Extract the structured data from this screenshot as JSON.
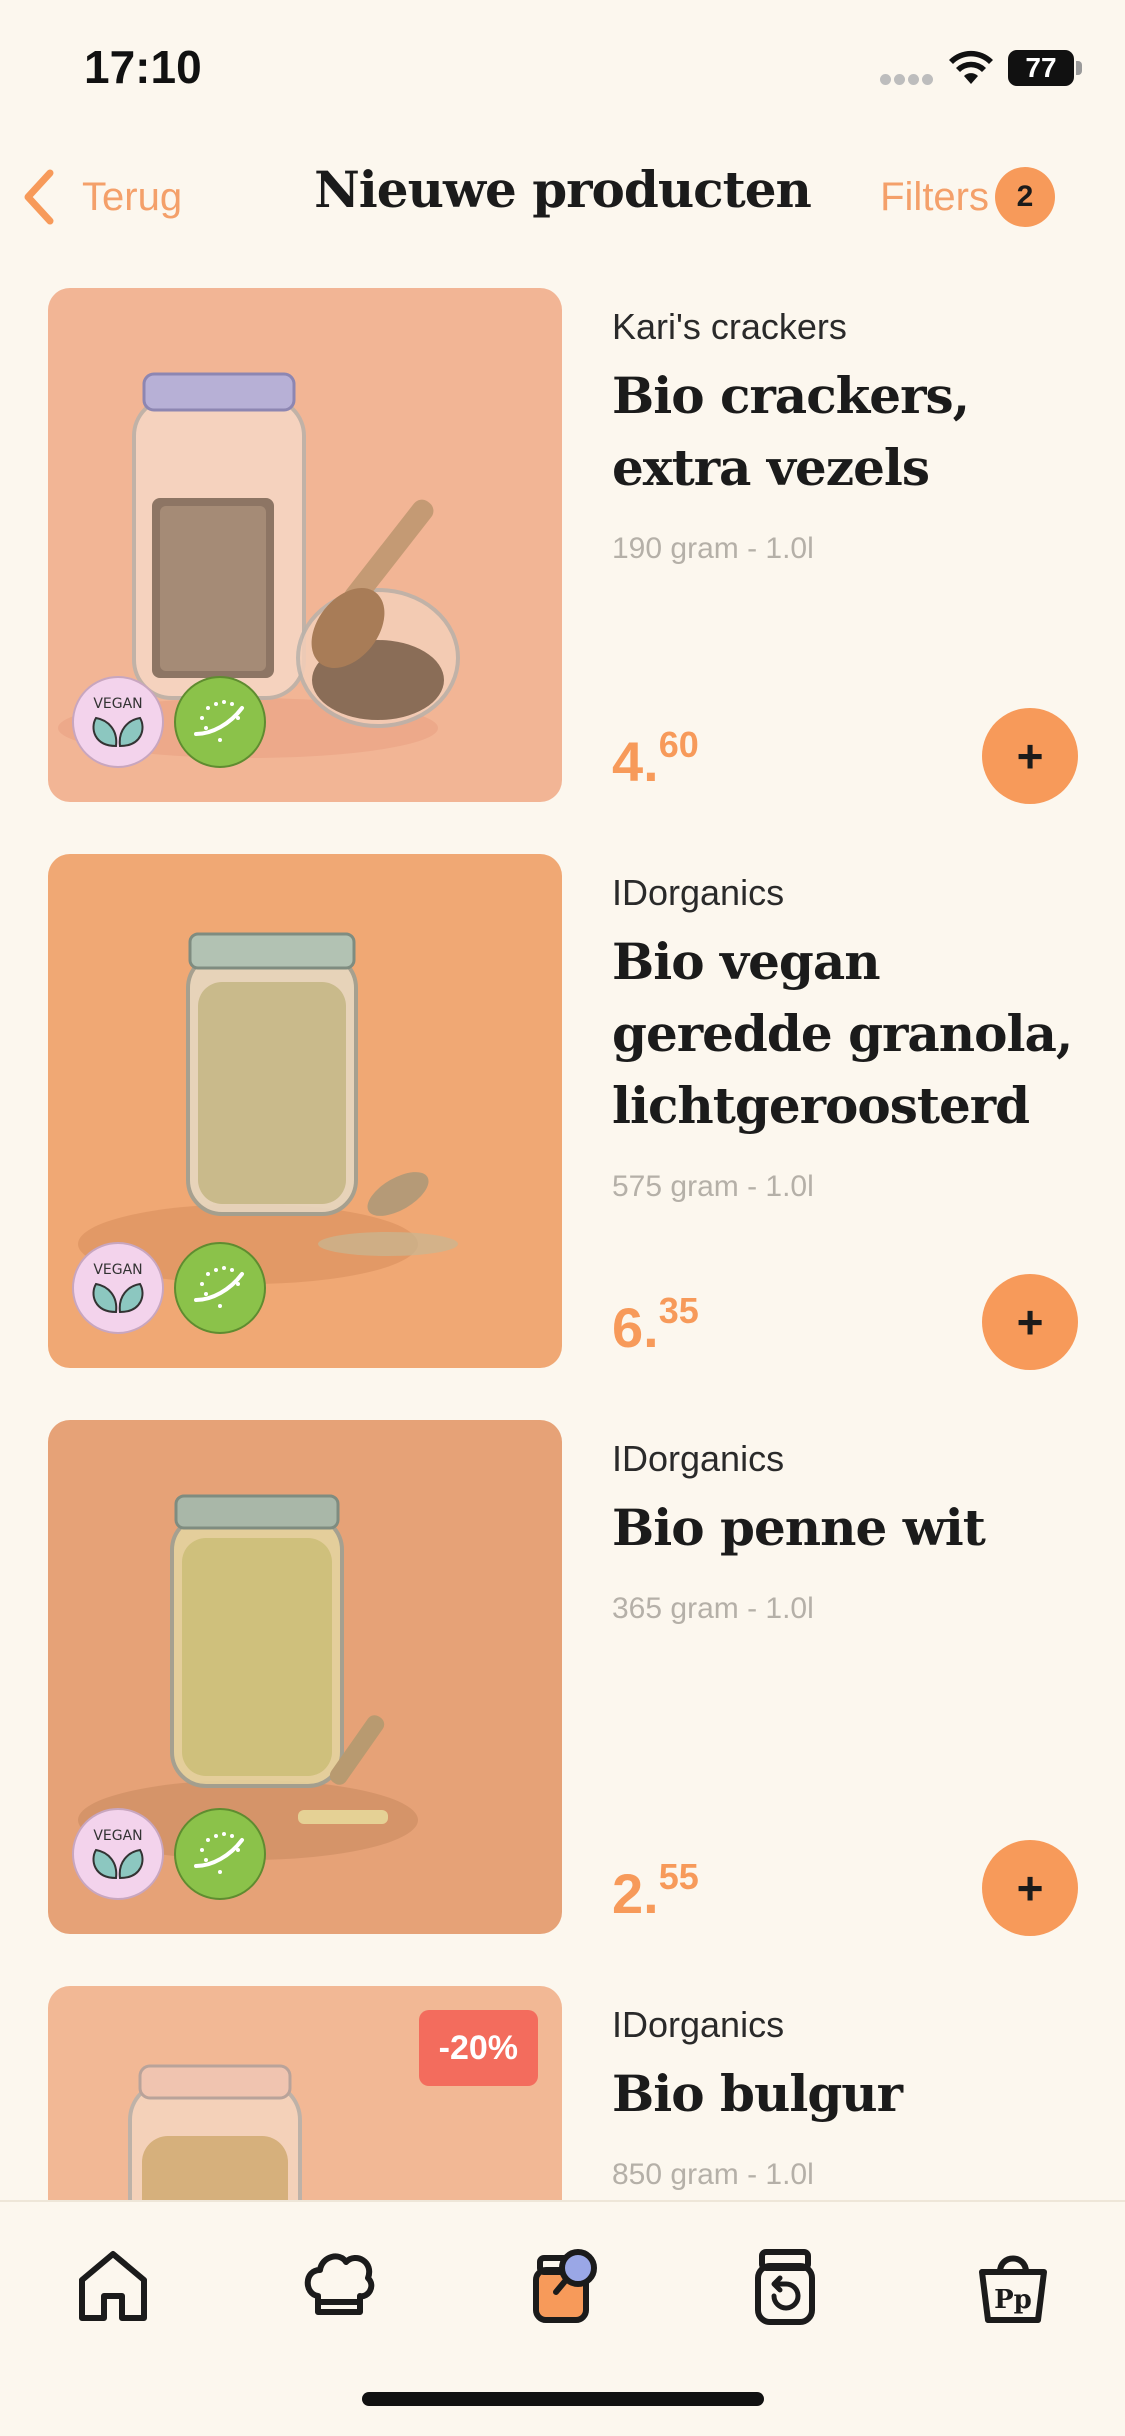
{
  "status_bar": {
    "time": "17:10",
    "battery": "77"
  },
  "header": {
    "back_label": "Terug",
    "title": "Nieuwe producten",
    "filters_label": "Filters",
    "filters_count": "2"
  },
  "products": [
    {
      "brand": "Kari's crackers",
      "name": "Bio crackers, extra vezels",
      "size": "190 gram - 1.0l",
      "price_main": "4.",
      "price_cents": "60",
      "badges": [
        "vegan",
        "bio"
      ]
    },
    {
      "brand": "IDorganics",
      "name": "Bio vegan geredde granola, lichtgeroosterd",
      "size": "575 gram - 1.0l",
      "price_main": "6.",
      "price_cents": "35",
      "badges": [
        "vegan",
        "bio"
      ]
    },
    {
      "brand": "IDorganics",
      "name": "Bio penne wit",
      "size": "365 gram - 1.0l",
      "price_main": "2.",
      "price_cents": "55",
      "badges": [
        "vegan",
        "bio"
      ]
    },
    {
      "brand": "IDorganics",
      "name": "Bio bulgur",
      "size": "850 gram - 1.0l",
      "discount": "-20%"
    }
  ],
  "badges_text": {
    "vegan": "VEGAN"
  },
  "add_label": "+",
  "tab_bar": [
    "home-icon",
    "chef-hat-icon",
    "jar-search-icon",
    "jar-refill-icon",
    "shopping-bag-icon"
  ],
  "colors": {
    "accent": "#F79A5A",
    "background": "#FCF7EE",
    "discount": "#F36C5D"
  }
}
